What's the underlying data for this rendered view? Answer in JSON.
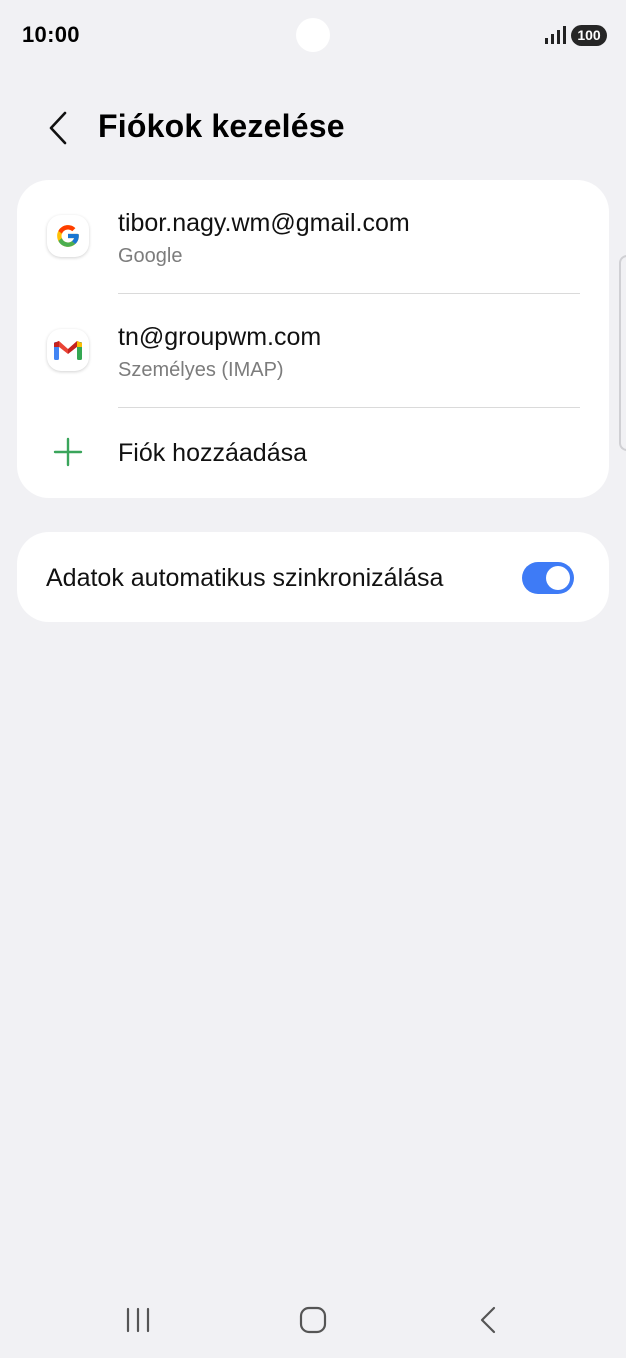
{
  "status_bar": {
    "time": "10:00",
    "battery": "100"
  },
  "header": {
    "title": "Fiókok kezelése"
  },
  "accounts": [
    {
      "email": "tibor.nagy.wm@gmail.com",
      "type": "Google",
      "icon": "google-icon"
    },
    {
      "email": "tn@groupwm.com",
      "type": "Személyes (IMAP)",
      "icon": "gmail-icon"
    }
  ],
  "add_account": {
    "label": "Fiók hozzáadása",
    "icon": "plus-icon"
  },
  "sync": {
    "label": "Adatok automatikus szinkronizálása",
    "enabled": true
  },
  "colors": {
    "accent": "#3e7bf6",
    "plus": "#3aa55b",
    "background": "#f1f1f4"
  }
}
